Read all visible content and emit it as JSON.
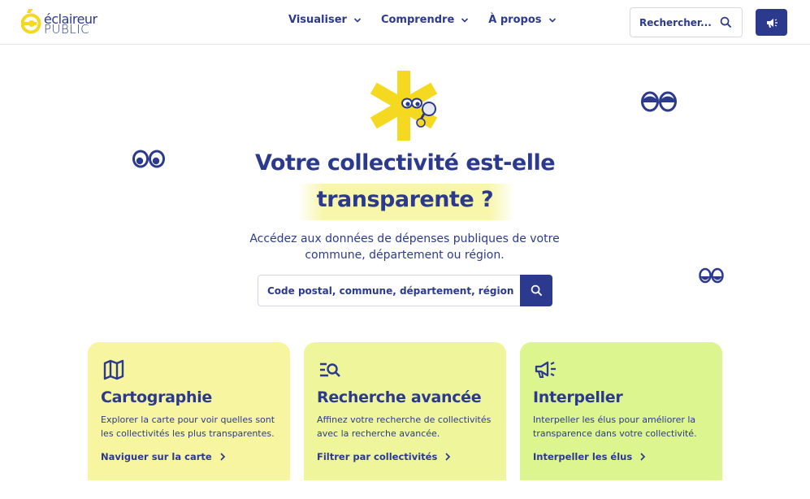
{
  "colors": {
    "primary": "#2b3a8c",
    "accent_yellow": "#f5d921",
    "card1": "#f7f5a0",
    "card2": "#eef59a",
    "card3": "#dcf58f"
  },
  "logo": {
    "line1": "éclaireur",
    "line2": "PUBLIC"
  },
  "nav": [
    {
      "label": "Visualiser",
      "icon": "chevron-down-icon"
    },
    {
      "label": "Comprendre",
      "icon": "chevron-down-icon"
    },
    {
      "label": "À propos",
      "icon": "chevron-down-icon"
    }
  ],
  "header_search": {
    "placeholder": "Rechercher...",
    "icon": "search-icon"
  },
  "header_action": {
    "icon": "megaphone-icon"
  },
  "hero": {
    "title_line1": "Votre collectivité est-elle",
    "title_line2": "transparente ?",
    "subtitle": "Accédez aux données de dépenses publiques de votre commune, département ou région."
  },
  "main_search": {
    "placeholder": "Code postal, commune, département, région",
    "icon": "search-icon"
  },
  "cards": [
    {
      "icon": "map-icon",
      "title": "Cartographie",
      "description": "Explorer la carte pour voir quelles sont les collectivités les plus transparentes.",
      "link": "Naviguer sur la carte"
    },
    {
      "icon": "search-list-icon",
      "title": "Recherche avancée",
      "description": "Affinez votre recherche de collectivités avec la recherche avancée.",
      "link": "Filtrer par collectivités"
    },
    {
      "icon": "megaphone-icon",
      "title": "Interpeller",
      "description": "Interpeller les élus pour améliorer la transparence dans votre collectivité.",
      "link": "Interpeller les élus"
    }
  ]
}
